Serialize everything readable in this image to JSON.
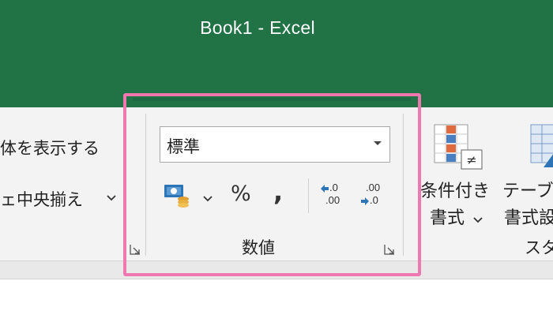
{
  "window": {
    "title": "Book1  -  Excel"
  },
  "alignment_group": {
    "show_all_label": "体を表示する",
    "merge_center_label": "ェ中央揃え"
  },
  "number_group": {
    "format_select": {
      "value": "標準"
    },
    "percent_label": "%",
    "comma_label": ",",
    "group_label": "数値",
    "increase_decimal": {
      "top": ".0",
      "bottom": ".00"
    },
    "decrease_decimal": {
      "top": ".00",
      "bottom": ".0"
    }
  },
  "styles_group": {
    "conditional_format_line1": "条件付き",
    "conditional_format_line2": "書式",
    "table_format_line1": "テーブル",
    "table_format_line2": "書式設",
    "group_label": "スタ"
  },
  "colors": {
    "title_bar": "#217346",
    "highlight": "#ef78b0",
    "accent_green": "#1e6b43"
  },
  "icons": {
    "accounting": "accounting-format-icon",
    "dropdown": "chevron-down-icon",
    "dialog_launcher": "dialog-launcher-icon"
  }
}
